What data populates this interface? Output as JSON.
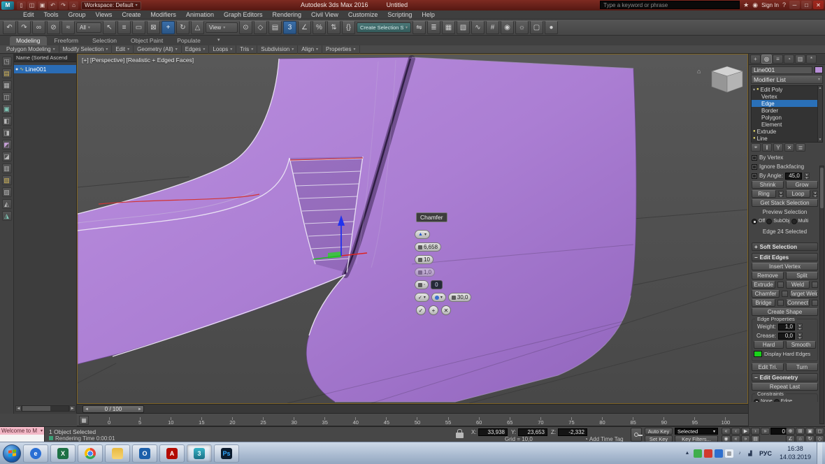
{
  "titlebar": {
    "logo": "M",
    "workspace": "Workspace: Default",
    "app_title": "Autodesk 3ds Max 2016",
    "doc_title": "Untitled",
    "search_placeholder": "Type a keyword or phrase",
    "sign_in": "Sign In",
    "quick_icons": [
      {
        "n": "new-scene-icon",
        "g": "▯"
      },
      {
        "n": "open-file-icon",
        "g": "◫"
      },
      {
        "n": "save-file-icon",
        "g": "▣"
      },
      {
        "n": "undo-quick-icon",
        "g": "↶"
      },
      {
        "n": "redo-quick-icon",
        "g": "↷"
      },
      {
        "n": "project-folder-icon",
        "g": "⌂"
      }
    ],
    "window_icons": [
      {
        "n": "minimize-icon",
        "g": "─",
        "cls": "winbtn"
      },
      {
        "n": "maximize-icon",
        "g": "□",
        "cls": "winbtn"
      },
      {
        "n": "close-icon",
        "g": "✕",
        "cls": "winbtn close"
      }
    ]
  },
  "menus": [
    "Edit",
    "Tools",
    "Group",
    "Views",
    "Create",
    "Modifiers",
    "Animation",
    "Graph Editors",
    "Rendering",
    "Civil View",
    "Customize",
    "Scripting",
    "Help"
  ],
  "toolbar": {
    "groupA": [
      {
        "n": "undo-icon",
        "g": "↶"
      },
      {
        "n": "redo-icon",
        "g": "↷"
      },
      {
        "n": "select-and-link-icon",
        "g": "∞"
      },
      {
        "n": "unlink-selection-icon",
        "g": "⊘"
      },
      {
        "n": "bind-to-space-warp-icon",
        "g": "≈"
      }
    ],
    "selection_filter": "All",
    "groupB": [
      {
        "n": "select-object-icon",
        "g": "↖"
      },
      {
        "n": "select-by-name-icon",
        "g": "≡"
      },
      {
        "n": "rectangular-selection-icon",
        "g": "▭"
      },
      {
        "n": "window-crossing-icon",
        "g": "⊠"
      },
      {
        "n": "select-and-move-icon",
        "g": "+",
        "cls": "ticon active"
      },
      {
        "n": "select-and-rotate-icon",
        "g": "↻"
      },
      {
        "n": "select-and-scale-icon",
        "g": "△"
      }
    ],
    "ref_coord": "View",
    "groupC": [
      {
        "n": "use-pivot-center-icon",
        "g": "⊙"
      },
      {
        "n": "select-and-manipulate-icon",
        "g": "◇"
      },
      {
        "n": "keyboard-shortcut-override-icon",
        "g": "▤"
      },
      {
        "n": "snaps-toggle-3d-icon",
        "g": "3",
        "cls": "ticon active"
      },
      {
        "n": "angle-snap-icon",
        "g": "∠"
      },
      {
        "n": "percent-snap-icon",
        "g": "%"
      },
      {
        "n": "spinner-snap-icon",
        "g": "⇅"
      },
      {
        "n": "named-selection-sets-icon",
        "g": "{}"
      }
    ],
    "named_selection": "Create Selection Se",
    "groupD": [
      {
        "n": "mirror-icon",
        "g": "⇋"
      },
      {
        "n": "align-icon",
        "g": "≣"
      },
      {
        "n": "layer-manager-icon",
        "g": "▦"
      },
      {
        "n": "graphite-ribbon-icon",
        "g": "▧"
      },
      {
        "n": "curve-editor-icon",
        "g": "∿"
      },
      {
        "n": "schematic-view-icon",
        "g": "#"
      },
      {
        "n": "material-editor-icon",
        "g": "◉"
      },
      {
        "n": "render-setup-icon",
        "g": "☼"
      },
      {
        "n": "rendered-frame-icon",
        "g": "▢"
      },
      {
        "n": "render-production-icon",
        "g": "●"
      }
    ]
  },
  "ribbon": {
    "tabs": [
      {
        "t": "Modeling",
        "cls": "rtab active"
      },
      {
        "t": "Freeform"
      },
      {
        "t": "Selection"
      },
      {
        "t": "Object Paint"
      },
      {
        "t": "Populate"
      }
    ],
    "panels": [
      "Polygon Modeling",
      "Modify Selection",
      "Edit",
      "Geometry (All)",
      "Edges",
      "Loops",
      "Tris",
      "Subdivision",
      "Align",
      "Properties"
    ]
  },
  "left_strip": [
    {
      "n": "explorer-tool-icon",
      "g": "◳"
    },
    {
      "n": "explorer-tool-icon",
      "g": "▤",
      "style": "color:#d4b85a"
    },
    {
      "n": "explorer-tool-icon",
      "g": "▦"
    },
    {
      "n": "explorer-tool-icon",
      "g": "◫"
    },
    {
      "n": "explorer-tool-icon",
      "g": "▣",
      "style": "color:#7fc8b8"
    },
    {
      "n": "explorer-tool-icon",
      "g": "◧"
    },
    {
      "n": "explorer-tool-icon",
      "g": "◨"
    },
    {
      "n": "explorer-tool-icon",
      "g": "◩",
      "style": "color:#c8a0d8"
    },
    {
      "n": "explorer-tool-icon",
      "g": "◪"
    },
    {
      "n": "explorer-tool-icon",
      "g": "▥"
    },
    {
      "n": "explorer-tool-icon",
      "g": "▧",
      "style": "color:#d4b85a"
    },
    {
      "n": "explorer-tool-icon",
      "g": "▨"
    },
    {
      "n": "explorer-tool-icon",
      "g": "◭"
    },
    {
      "n": "explorer-tool-icon",
      "g": "◮",
      "style": "color:#7fc8b8"
    }
  ],
  "explorer": {
    "header": "Name (Sorted Ascend",
    "item": "Line001"
  },
  "viewport": {
    "label": "[+] [Perspective] [Realistic + Edged Faces]",
    "caddy": {
      "title": "Chamfer",
      "amount": "6,658",
      "segments": "10",
      "depth": "1,0",
      "open": "0",
      "tension": "30,0"
    }
  },
  "panel": {
    "tabs": [
      {
        "n": "tab-create-icon",
        "g": "+"
      },
      {
        "n": "tab-modify-icon",
        "g": "◎",
        "cls": "ptab active"
      },
      {
        "n": "tab-hierarchy-icon",
        "g": "≡"
      },
      {
        "n": "tab-motion-icon",
        "g": "◔"
      },
      {
        "n": "tab-display-icon",
        "g": "▥"
      },
      {
        "n": "tab-utilities-icon",
        "g": "*"
      }
    ],
    "name": "Line001",
    "modifier_list": "Modifier List",
    "stack": {
      "s0": "Edit Poly",
      "s1": "Vertex",
      "s2": "Edge",
      "s3": "Border",
      "s4": "Polygon",
      "s5": "Element",
      "s6": "Extrude",
      "s7": "Line"
    },
    "r": {
      "by_vertex": "By Vertex",
      "ignore_backfacing": "Ignore Backfacing",
      "by_angle": "By Angle:",
      "by_angle_val": "45,0",
      "shrink": "Shrink",
      "grow": "Grow",
      "ring": "Ring",
      "loop": "Loop",
      "get_stack": "Get Stack Selection",
      "preview": "Preview Selection",
      "off": "Off",
      "subobj": "SubObj",
      "multi": "Multi",
      "sel_info": "Edge 24 Selected",
      "soft_selection": "Soft Selection",
      "edit_edges": "Edit Edges",
      "insert_vertex": "Insert Vertex",
      "remove": "Remove",
      "split": "Split",
      "extrude": "Extrude",
      "weld": "Weld",
      "chamfer": "Chamfer",
      "target_weld": "Target Weld",
      "bridge": "Bridge",
      "connect": "Connect",
      "create_shape": "Create Shape",
      "edge_properties": "Edge Properties",
      "weight": "Weight:",
      "weight_val": "1,0",
      "crease": "Crease:",
      "crease_val": "0,0",
      "hard": "Hard",
      "smooth": "Smooth",
      "display_hard_edges": "Display Hard Edges",
      "edit_tri": "Edit Tri.",
      "turn": "Turn",
      "edit_geometry": "Edit Geometry",
      "repeat_last": "Repeat Last",
      "constraints": "Constraints",
      "none": "None",
      "edge": "Edge"
    }
  },
  "timeline": {
    "slider": "0 / 100",
    "ticks": [
      "0",
      "5",
      "10",
      "15",
      "20",
      "25",
      "30",
      "35",
      "40",
      "45",
      "50",
      "55",
      "60",
      "65",
      "70",
      "75",
      "80",
      "85",
      "90",
      "95",
      "100"
    ]
  },
  "status": {
    "listener": "Welcome to M",
    "selected": "1 Object Selected",
    "prompt": "Rendering Time 0:00:01",
    "x": "X:",
    "xv": "33,938",
    "y": "Y:",
    "yv": "23,653",
    "z": "Z:",
    "zv": "-2,332",
    "grid": "Grid = 10,0",
    "add_time_tag": "Add Time Tag",
    "auto_key": "Auto Key",
    "set_key": "Set Key",
    "sel_set": "Selected",
    "key_filters": "Key Filters...",
    "time": "0"
  },
  "colors": {
    "object_purple": "#ab7ed3",
    "selection_blue": "#2a70b8",
    "hard_edge_green": "#19d219"
  },
  "taskbar": {
    "apps": [
      {
        "n": "taskbar-app-ie",
        "style": "background:#2a6fd4;color:#fff;border-radius:50%",
        "g": "e"
      },
      {
        "n": "taskbar-app-excel",
        "style": "background:#1e7145;color:#fff",
        "g": "X"
      },
      {
        "n": "taskbar-app-chrome",
        "style": "background:radial-gradient(circle,#4285f4 0 30%,#fff 30% 38%,rgba(0,0,0,0) 38%),conic-gradient(#ea4335 0 33%,#34a853 33% 66%,#fbbc05 66% 100%);border-radius:50%",
        "g": ""
      },
      {
        "n": "taskbar-app-folder",
        "style": "background:linear-gradient(#e8b93e,#f6d475);color:#b9862a",
        "g": ""
      },
      {
        "n": "taskbar-app-outlook",
        "style": "background:#1b5faa;color:#fff",
        "g": "O"
      },
      {
        "n": "taskbar-app-acrobat",
        "style": "background:#b30b00;color:#fff",
        "g": "A"
      },
      {
        "n": "taskbar-app-3dsmax",
        "cls": "app active",
        "style": "background:linear-gradient(#39b5c8,#1a7086);color:#eafcff",
        "g": "3"
      },
      {
        "n": "taskbar-app-photoshop",
        "style": "background:#0c1c2e;color:#31a8ff",
        "g": "Ps"
      }
    ],
    "tray": [
      {
        "n": "tray-show-hidden-icon",
        "style": "background:rgba(0,0,0,0);color:#2a3a55",
        "g": "▲"
      },
      {
        "n": "tray-icon",
        "style": "background:#3fae4a",
        "g": ""
      },
      {
        "n": "tray-icon",
        "style": "background:#d23b2e",
        "g": ""
      },
      {
        "n": "tray-icon",
        "style": "background:#2d6fce",
        "g": ""
      },
      {
        "n": "tray-icon",
        "style": "background:#e8eef5;color:#333",
        "g": "▥"
      },
      {
        "n": "tray-volume-icon",
        "style": "background:rgba(0,0,0,0);color:#2a3a55",
        "g": "♪"
      },
      {
        "n": "tray-network-icon",
        "style": "background:rgba(0,0,0,0);color:#2a3a55",
        "g": "▟"
      }
    ],
    "lang": "РУС",
    "time": "16:38",
    "date": "14.03.2019"
  }
}
